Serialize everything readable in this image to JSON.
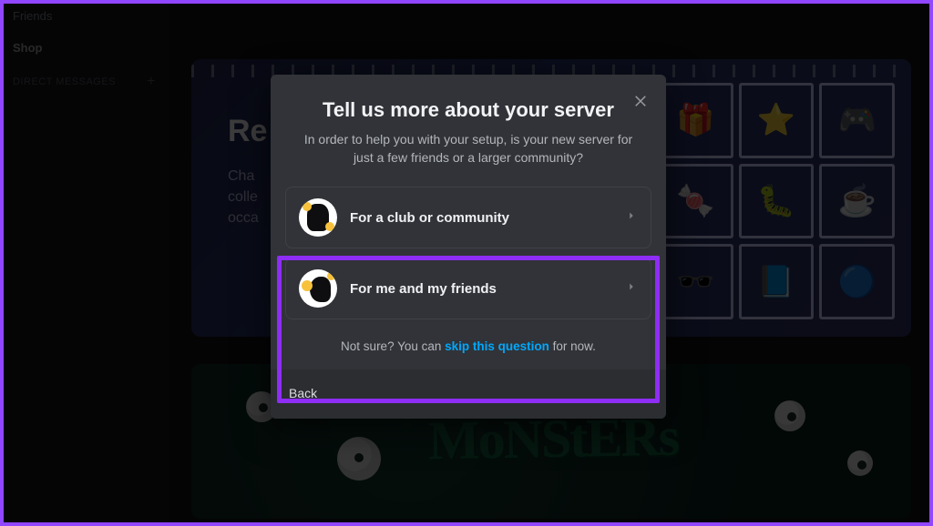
{
  "sidebar": {
    "friends": "Friends",
    "shop": "Shop",
    "dm_header": "DIRECT MESSAGES"
  },
  "promo": {
    "title_fragment": "Re",
    "body_line1": "Cha",
    "body_line2": "colle",
    "body_line3": "occa"
  },
  "monsters": {
    "title": "MoNStERs"
  },
  "modal": {
    "title": "Tell us more about your server",
    "subtitle": "In order to help you with your setup, is your new server for just a few friends or a larger community?",
    "options": [
      {
        "label": "For a club or community"
      },
      {
        "label": "For me and my friends"
      }
    ],
    "skip_prefix": "Not sure? You can ",
    "skip_link": "skip this question",
    "skip_suffix": " for now.",
    "back": "Back"
  }
}
